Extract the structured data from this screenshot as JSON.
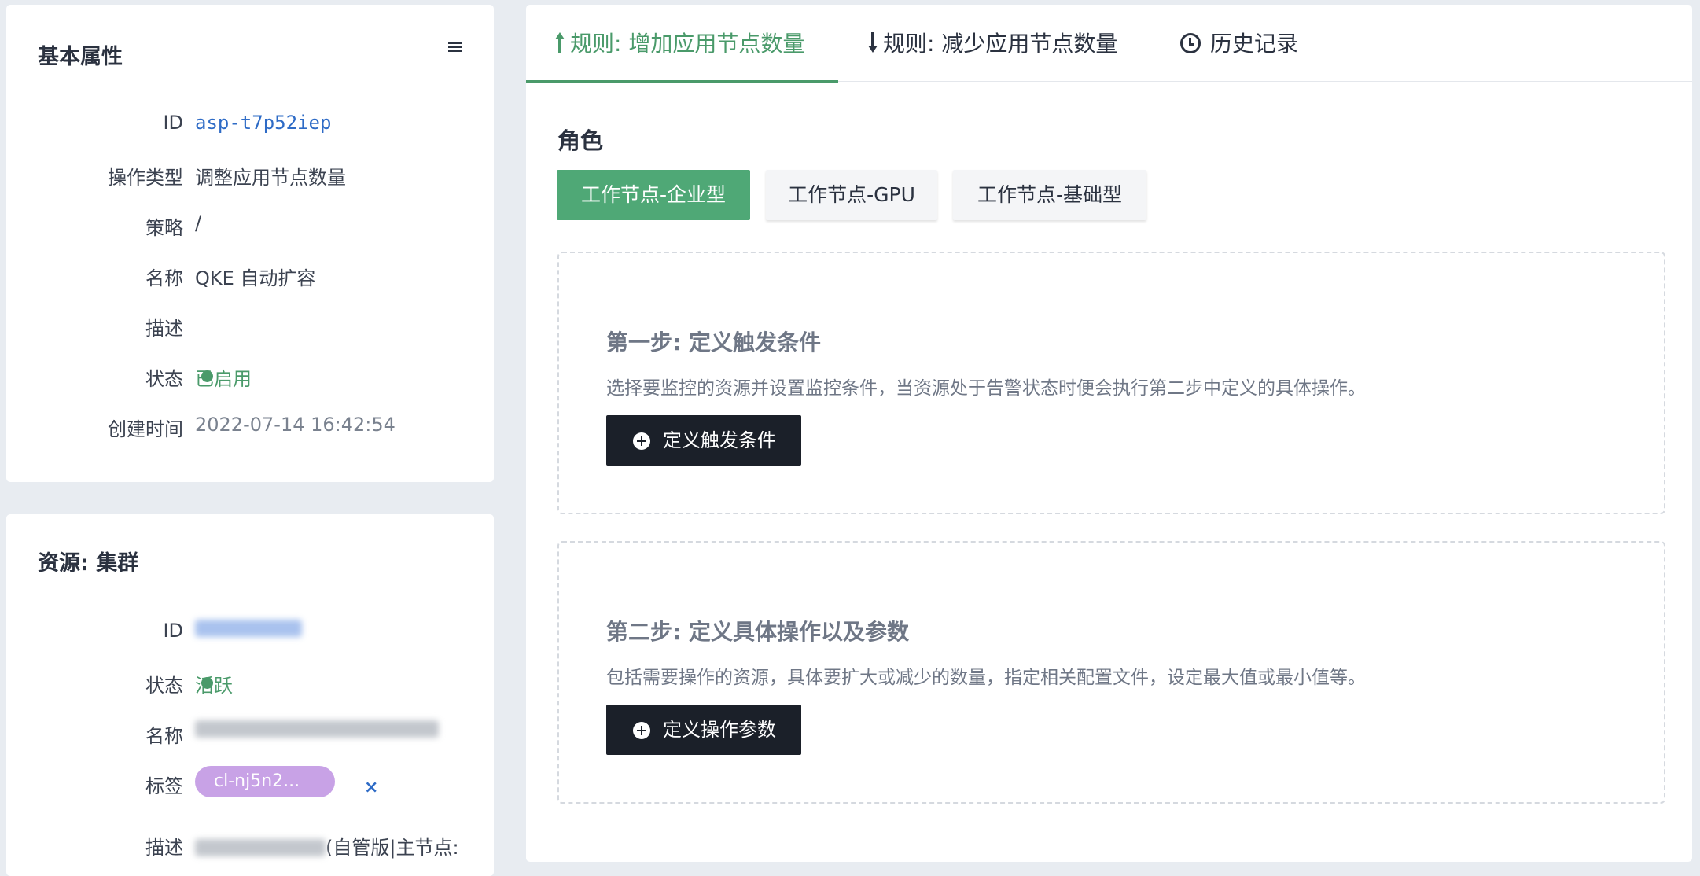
{
  "basic": {
    "title": "基本属性",
    "rows": [
      {
        "label": "ID",
        "value": "asp-t7p52iep"
      },
      {
        "label": "操作类型",
        "value": "调整应用节点数量"
      },
      {
        "label": "策略",
        "value": "/"
      },
      {
        "label": "名称",
        "value": "QKE 自动扩容"
      },
      {
        "label": "描述",
        "value": ""
      },
      {
        "label": "状态",
        "value": "已启用"
      },
      {
        "label": "创建时间",
        "value": "2022-07-14 16:42:54"
      }
    ]
  },
  "resource": {
    "title": "资源: 集群",
    "rows": [
      {
        "label": "ID",
        "value": ""
      },
      {
        "label": "状态",
        "value": "活跃"
      },
      {
        "label": "名称",
        "value": ""
      },
      {
        "label": "标签",
        "value": "cl-nj5n2..."
      },
      {
        "label": "描述",
        "value": "(自管版|主节点:"
      }
    ]
  },
  "tabs": [
    {
      "label": "规则: 增加应用节点数量"
    },
    {
      "label": "规则: 减少应用节点数量"
    },
    {
      "label": "历史记录"
    }
  ],
  "role": {
    "title": "角色",
    "options": [
      "工作节点-企业型",
      "工作节点-GPU",
      "工作节点-基础型"
    ]
  },
  "steps": [
    {
      "title": "第一步: 定义触发条件",
      "desc": "选择要监控的资源并设置监控条件，当资源处于告警状态时便会执行第二步中定义的具体操作。",
      "button": "定义触发条件"
    },
    {
      "title": "第二步: 定义具体操作以及参数",
      "desc": "包括需要操作的资源，具体要扩大或减少的数量，指定相关配置文件，设定最大值或最小值等。",
      "button": "定义操作参数"
    }
  ],
  "colors": {
    "accent": "#4a9a6a",
    "link": "#2e6bc6",
    "tag": "#c8a2e6",
    "dark_button": "#1b2029"
  }
}
